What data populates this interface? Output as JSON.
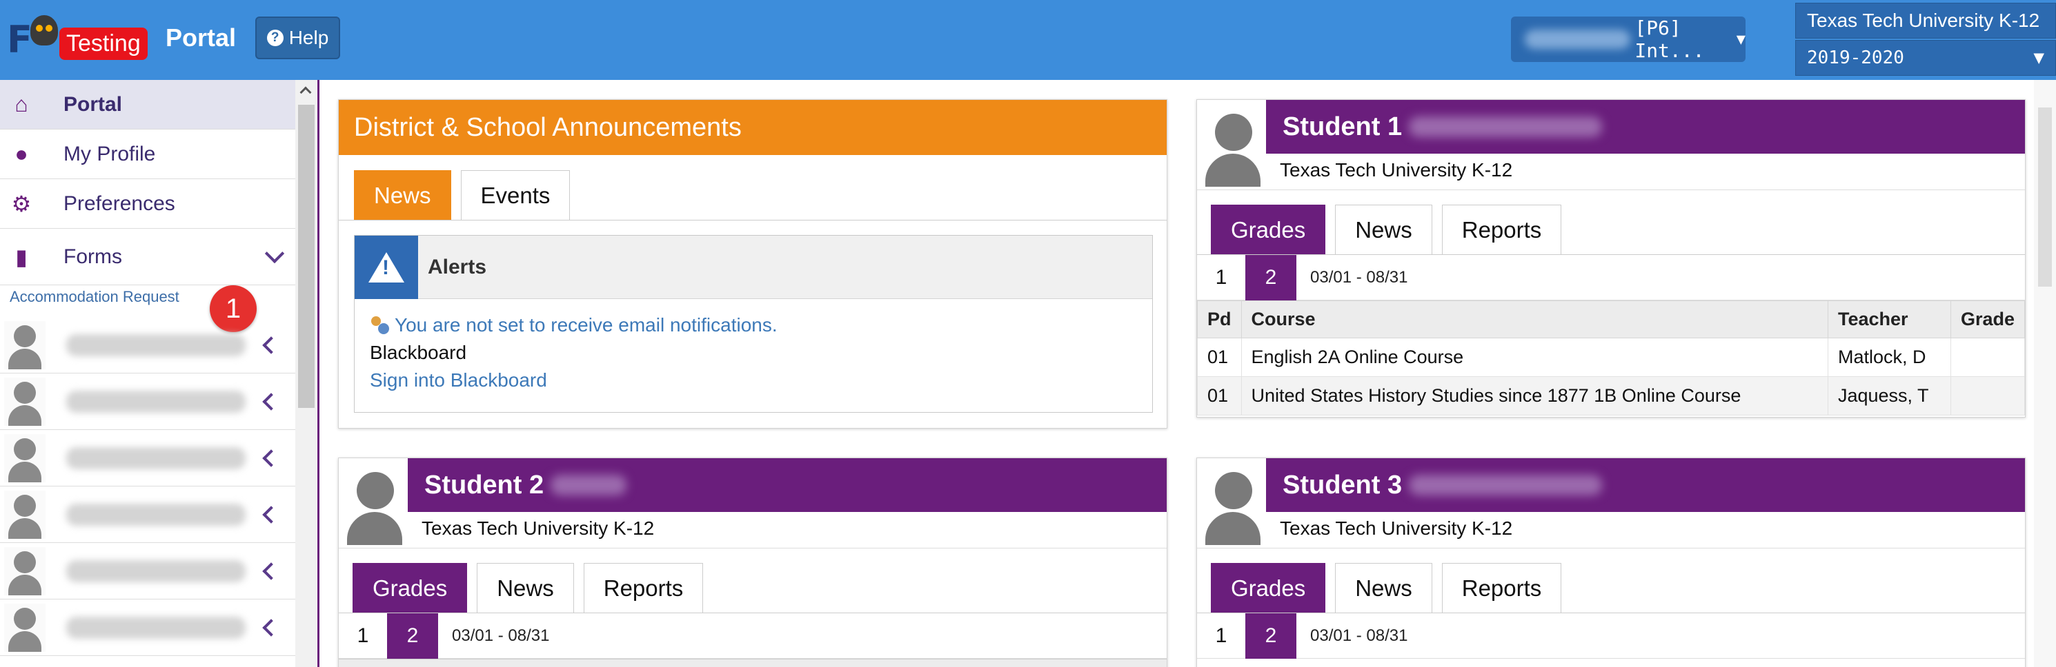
{
  "header": {
    "logo_letters": "F",
    "logo_badge": "Testing",
    "title": "Portal",
    "help_label": "Help",
    "user_selector_visible_text": "[P6] Int...",
    "school": "Texas Tech University K-12",
    "year": "2019-2020"
  },
  "sidebar": {
    "items": [
      {
        "label": "Portal",
        "icon": "home-icon"
      },
      {
        "label": "My Profile",
        "icon": "user-icon"
      },
      {
        "label": "Preferences",
        "icon": "gear-icon"
      },
      {
        "label": "Forms",
        "icon": "file-icon"
      }
    ],
    "subitem": "Accommodation Request",
    "notification_count": "1",
    "children_count": 6
  },
  "announcements": {
    "title": "District & School Announcements",
    "tabs": [
      "News",
      "Events"
    ],
    "active_tab": "News",
    "alerts_title": "Alerts",
    "alert_email": "You are not set to receive email notifications.",
    "blackboard_label": "Blackboard",
    "blackboard_link": "Sign into Blackboard"
  },
  "students": [
    {
      "name": "Student 1",
      "school": "Texas Tech University K-12",
      "tabs": [
        "Grades",
        "News",
        "Reports"
      ],
      "terms": [
        "1",
        "2"
      ],
      "active_term": "2",
      "term_range": "03/01 - 08/31",
      "columns": [
        "Pd",
        "Course",
        "Teacher",
        "Grade"
      ],
      "rows": [
        [
          "01",
          "English 2A Online Course",
          "Matlock, D",
          ""
        ],
        [
          "01",
          "United States History Studies since 1877 1B Online Course",
          "Jaquess, T",
          ""
        ]
      ]
    },
    {
      "name": "Student 2",
      "school": "Texas Tech University K-12",
      "tabs": [
        "Grades",
        "News",
        "Reports"
      ],
      "terms": [
        "1",
        "2"
      ],
      "active_term": "2",
      "term_range": "03/01 - 08/31"
    },
    {
      "name": "Student 3",
      "school": "Texas Tech University K-12",
      "tabs": [
        "Grades",
        "News",
        "Reports"
      ],
      "terms": [
        "1",
        "2"
      ],
      "active_term": "2",
      "term_range": "03/01 - 08/31"
    }
  ],
  "colors": {
    "topbar": "#3d8ddb",
    "accent_orange": "#ef8a17",
    "accent_purple": "#6a1e7c",
    "link_blue": "#3d79b8",
    "notification_red": "#e5302e"
  }
}
